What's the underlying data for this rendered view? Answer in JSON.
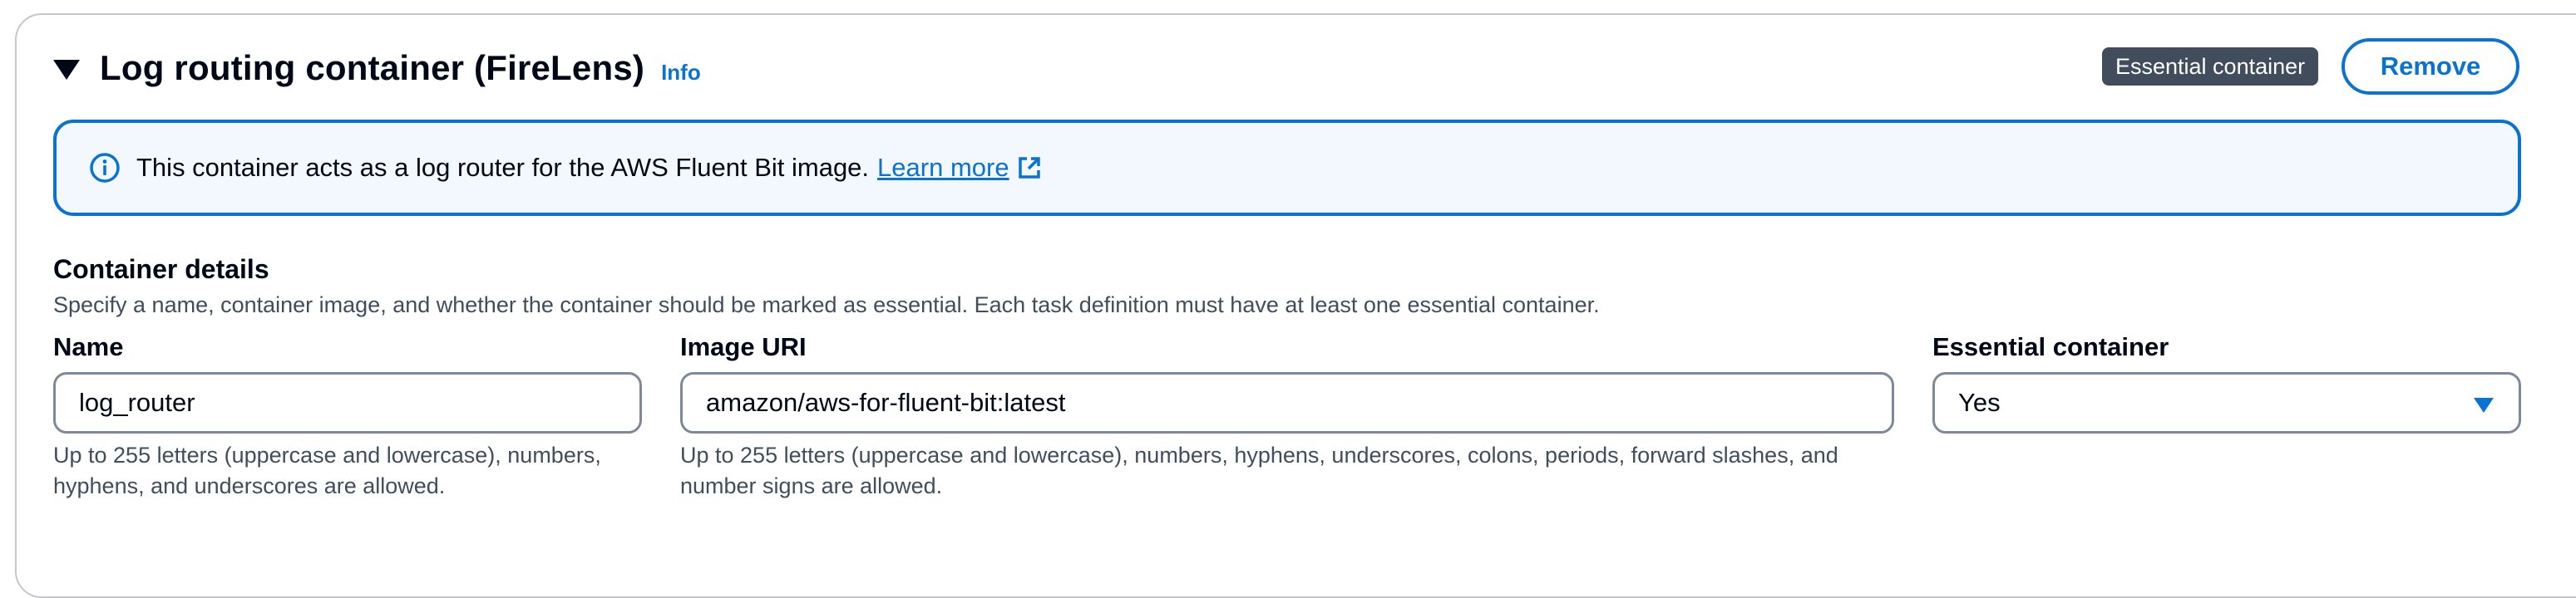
{
  "section": {
    "title": "Log routing container (FireLens)",
    "info_link": "Info",
    "badge": "Essential container",
    "remove_button": "Remove"
  },
  "alert": {
    "text": "This container acts as a log router for the AWS Fluent Bit image.",
    "link": "Learn more"
  },
  "container_details": {
    "title": "Container details",
    "description": "Specify a name, container image, and whether the container should be marked as essential. Each task definition must have at least one essential container."
  },
  "fields": {
    "name": {
      "label": "Name",
      "value": "log_router",
      "hint": "Up to 255 letters (uppercase and lowercase), numbers, hyphens, and underscores are allowed."
    },
    "image_uri": {
      "label": "Image URI",
      "value": "amazon/aws-for-fluent-bit:latest",
      "hint": "Up to 255 letters (uppercase and lowercase), numbers, hyphens, underscores, colons, periods, forward slashes, and number signs are allowed."
    },
    "essential": {
      "label": "Essential container",
      "value": "Yes"
    }
  },
  "colors": {
    "accent": "#0972d3",
    "alert_background": "#f2f8fd",
    "badge_background": "#414d5c",
    "text": "#000716",
    "secondary_text": "#414d5c",
    "input_border": "#7d8998",
    "panel_border": "#c6c6cd"
  },
  "icons": {
    "collapse": "caret-down-icon",
    "alert": "info-circle-icon",
    "external_link": "external-link-icon",
    "select": "caret-down-filled-icon"
  }
}
